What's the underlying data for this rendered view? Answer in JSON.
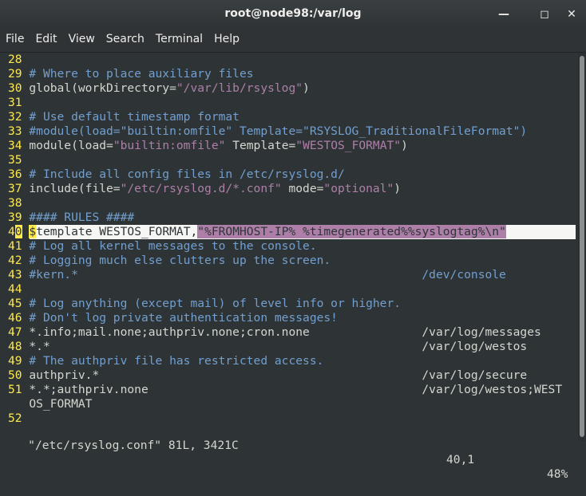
{
  "window": {
    "title": "root@node98:/var/log",
    "minimize": "—",
    "maximize": "◻",
    "close": "✕"
  },
  "menu": [
    "File",
    "Edit",
    "View",
    "Search",
    "Terminal",
    "Help"
  ],
  "lines": [
    {
      "n": "28",
      "t": ""
    },
    {
      "n": "29",
      "t": "# Where to place auxiliary files"
    },
    {
      "n": "30",
      "p": "global(workDirectory=",
      "s": "\"/var/lib/rsyslog\"",
      "q": ")"
    },
    {
      "n": "31",
      "t": ""
    },
    {
      "n": "32",
      "t": "# Use default timestamp format"
    },
    {
      "n": "33",
      "t": "#module(load=\"builtin:omfile\" Template=\"RSYSLOG_TraditionalFileFormat\")"
    },
    {
      "n": "34",
      "p": "module(load=",
      "s": "\"builtin:omfile\"",
      "q": " Template=",
      "s2": "\"WESTOS_FORMAT\"",
      "q2": ")"
    },
    {
      "n": "35",
      "t": ""
    },
    {
      "n": "36",
      "t": "# Include all config files in /etc/rsyslog.d/"
    },
    {
      "n": "37",
      "p": "include(file=",
      "s": "\"/etc/rsyslog.d/*.conf\"",
      "q": " mode=",
      "s2": "\"optional\"",
      "q2": ")"
    },
    {
      "n": "38",
      "t": ""
    },
    {
      "n": "39",
      "t": "#### RULES ####"
    },
    {
      "n": "40",
      "cur": true
    },
    {
      "n": "41",
      "t": "# Log all kernel messages to the console."
    },
    {
      "n": "42",
      "t": "# Logging much else clutters up the screen."
    },
    {
      "n": "43",
      "t": "#kern.*                                                 /dev/console"
    },
    {
      "n": "44",
      "t": ""
    },
    {
      "n": "45",
      "t": "# Log anything (except mail) of level info or higher."
    },
    {
      "n": "46",
      "t": "# Don't log private authentication messages!"
    },
    {
      "n": "47",
      "p": "*.info;mail.none;authpriv.none;cron.none                /var/log/messages"
    },
    {
      "n": "48",
      "p": "*.*                                                     /var/log/westos"
    },
    {
      "n": "49",
      "t": "# The authpriv file has restricted access."
    },
    {
      "n": "50",
      "p": "authpriv.*                                              /var/log/secure"
    },
    {
      "n": "51",
      "p": "*.*;authpriv.none                                       /var/log/westos;WEST"
    },
    {
      "n": "",
      "p": "OS_FORMAT"
    },
    {
      "n": "52",
      "t": ""
    }
  ],
  "cursor_line": {
    "num_first": "4",
    "num_rest": "0",
    "cursor_char": "$",
    "text": "template WESTOS_FORMAT,",
    "string": "\"%FROMHOST-IP% %timegenerated%%syslogtag%\\n\""
  },
  "status": {
    "file": "\"/etc/rsyslog.conf\" 81L, 3421C",
    "position": "40,1",
    "percent": "48%"
  },
  "colors": {
    "background": "#2e3436",
    "line_number": "#fce94f",
    "comment": "#729fcf",
    "string": "#ad7fa8",
    "cursorline": "#f6f6f4"
  }
}
